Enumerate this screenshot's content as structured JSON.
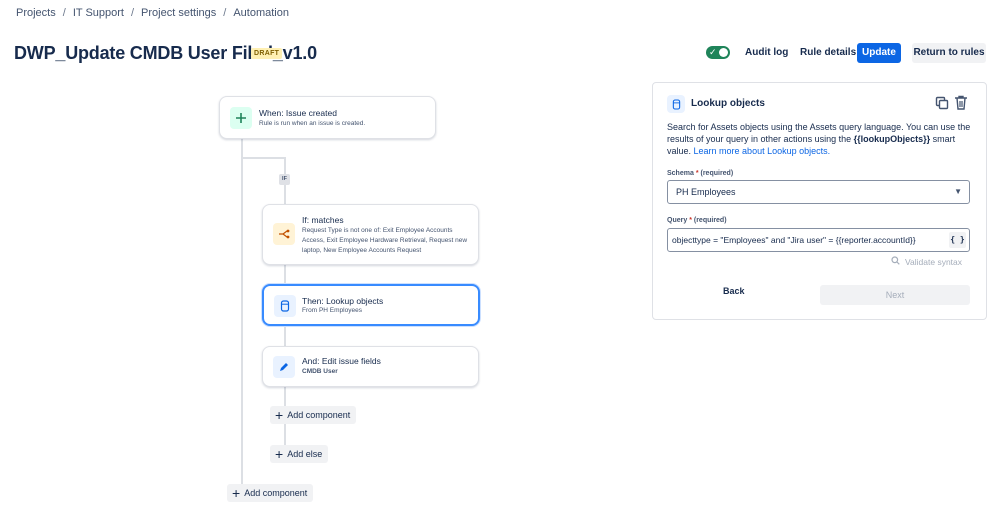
{
  "breadcrumb": [
    "Projects",
    "IT Support",
    "Project settings",
    "Automation"
  ],
  "header": {
    "title": "DWP_Update CMDB User Filed_v1.0",
    "badge": "DRAFT",
    "audit_log": "Audit log",
    "rule_details": "Rule details",
    "update": "Update",
    "return_to_rules": "Return to rules",
    "toggle_on": true
  },
  "flow": {
    "trigger": {
      "title": "When: Issue created",
      "desc": "Rule is run when an issue is created.",
      "icon": "plus-icon"
    },
    "if_tag": "IF",
    "condition": {
      "title": "If: matches",
      "desc": "Request Type is not one of: Exit Employee Accounts Access, Exit Employee Hardware Retrieval, Request new laptop, New Employee Accounts Request",
      "icon": "branch-icon"
    },
    "action1": {
      "title": "Then: Lookup objects",
      "desc": "From PH Employees",
      "icon": "database-icon"
    },
    "action2": {
      "title": "And: Edit issue fields",
      "desc": "CMDB User",
      "icon": "pencil-icon"
    },
    "add_component_inner": "Add component",
    "add_else": "Add else",
    "add_component_outer": "Add component"
  },
  "panel": {
    "title": "Lookup objects",
    "text_pre": "Search for Assets objects using the Assets query language. You can use the results of your query in other actions using the ",
    "smart_value": "{{lookupObjects}}",
    "text_mid": " smart value. ",
    "learn_more": "Learn more about Lookup objects.",
    "schema_label": "Schema",
    "required": "(required)",
    "schema_value": "PH Employees",
    "query_label": "Query",
    "query_value": "objecttype = \"Employees\" and \"Jira user\" = {{reporter.accountId}}",
    "brace_button": "{ }",
    "validate": "Validate syntax",
    "back": "Back",
    "next": "Next"
  },
  "colors": {
    "primary": "#0c66e4",
    "toggle_on": "#1f845a",
    "selected_border": "#388bff",
    "draft_bg": "#fff0b3"
  }
}
